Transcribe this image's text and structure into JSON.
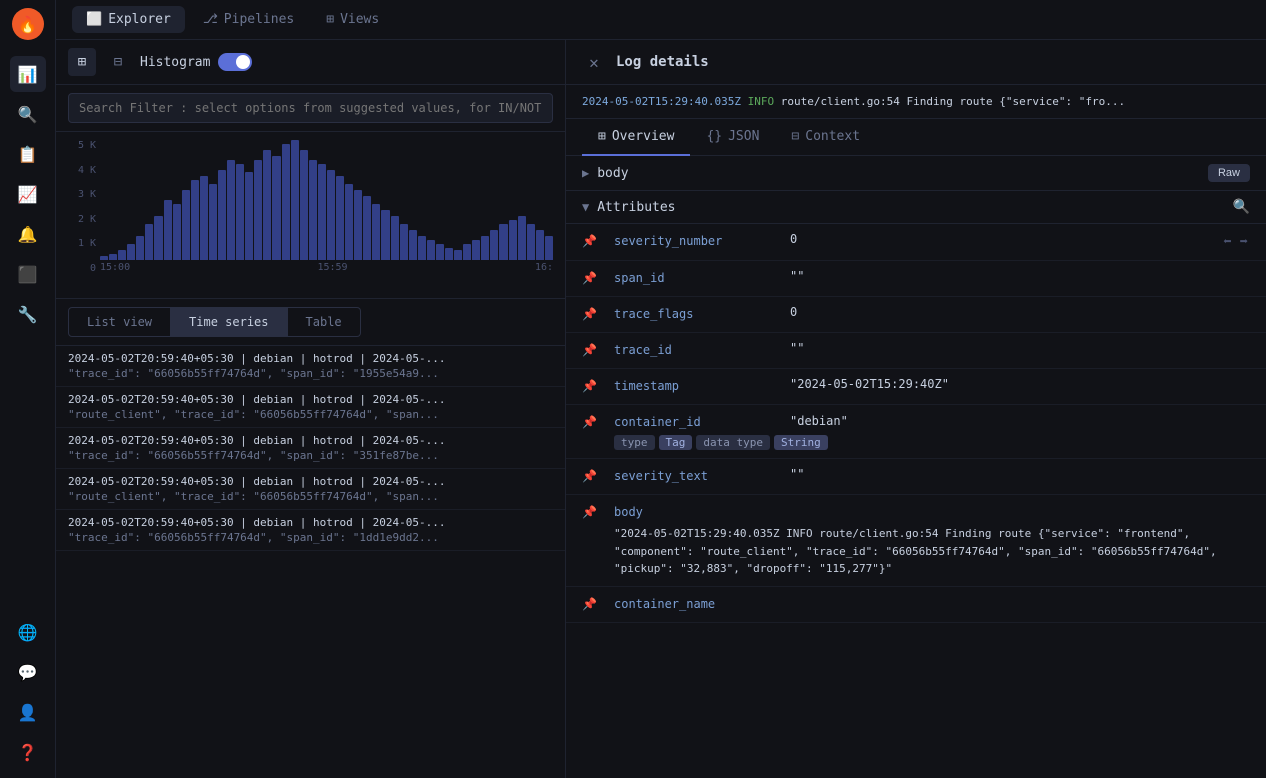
{
  "app": {
    "title": "Log details"
  },
  "sidebar": {
    "logo": "🔥",
    "icons": [
      "📊",
      "🔍",
      "📋",
      "📈",
      "🔔",
      "🔧",
      "⚙️"
    ],
    "bottom_icons": [
      "🌐",
      "💬",
      "👤",
      "❓"
    ]
  },
  "nav": {
    "tabs": [
      {
        "label": "Explorer",
        "active": true,
        "icon": "⬜"
      },
      {
        "label": "Pipelines",
        "active": false,
        "icon": "⎇"
      },
      {
        "label": "Views",
        "active": false,
        "icon": "⊞"
      }
    ]
  },
  "toolbar": {
    "histogram_label": "Histogram",
    "toggle_on": true
  },
  "search": {
    "placeholder": "Search Filter : select options from suggested values, for IN/NOT IN opera..."
  },
  "chart": {
    "y_labels": [
      "5 K",
      "4 K",
      "3 K",
      "2 K",
      "1 K",
      "0"
    ],
    "x_labels": [
      "15:00",
      "15:59",
      "16:"
    ],
    "bars": [
      2,
      3,
      5,
      8,
      12,
      18,
      22,
      30,
      28,
      35,
      40,
      42,
      38,
      45,
      50,
      48,
      44,
      50,
      55,
      52,
      58,
      60,
      55,
      50,
      48,
      45,
      42,
      38,
      35,
      32,
      28,
      25,
      22,
      18,
      15,
      12,
      10,
      8,
      6,
      5,
      8,
      10,
      12,
      15,
      18,
      20,
      22,
      18,
      15,
      12
    ]
  },
  "view_tabs": [
    {
      "label": "List view",
      "active": false
    },
    {
      "label": "Time series",
      "active": true
    },
    {
      "label": "Table",
      "active": false
    }
  ],
  "logs": [
    {
      "line1": "2024-05-02T20:59:40+05:30  |  debian  |  hotrod  |  2024-05-...",
      "line2": "\"trace_id\": \"66056b55ff74764d\", \"span_id\": \"1955e54a9..."
    },
    {
      "line1": "2024-05-02T20:59:40+05:30  |  debian  |  hotrod  |  2024-05-...",
      "line2": "\"route_client\", \"trace_id\": \"66056b55ff74764d\", \"span..."
    },
    {
      "line1": "2024-05-02T20:59:40+05:30  |  debian  |  hotrod  |  2024-05-...",
      "line2": "\"trace_id\": \"66056b55ff74764d\", \"span_id\": \"351fe87be..."
    },
    {
      "line1": "2024-05-02T20:59:40+05:30  |  debian  |  hotrod  |  2024-05-...",
      "line2": "\"route_client\", \"trace_id\": \"66056b55ff74764d\", \"span..."
    },
    {
      "line1": "2024-05-02T20:59:40+05:30  |  debian  |  hotrod  |  2024-05-...",
      "line2": "\"trace_id\": \"66056b55ff74764d\", \"span_id\": \"1dd1e9dd2..."
    }
  ],
  "detail": {
    "title": "Log details",
    "log_preview": "2024-05-02T15:29:40.035Z  INFO  route/client.go:54  Finding route  {\"service\": \"fro...",
    "tabs": [
      {
        "label": "Overview",
        "icon": "⊞",
        "active": true
      },
      {
        "label": "JSON",
        "icon": "{}",
        "active": false
      },
      {
        "label": "Context",
        "icon": "⊟",
        "active": false
      }
    ],
    "sections": {
      "body": {
        "name": "body",
        "raw_label": "Raw"
      },
      "attributes": {
        "name": "Attributes"
      }
    },
    "attributes": [
      {
        "name": "severity_number",
        "value": "0",
        "has_tags": false,
        "show_actions": true
      },
      {
        "name": "span_id",
        "value": "\"\"",
        "has_tags": false,
        "show_actions": false
      },
      {
        "name": "trace_flags",
        "value": "0",
        "has_tags": false,
        "show_actions": false
      },
      {
        "name": "trace_id",
        "value": "\"\"",
        "has_tags": false,
        "show_actions": false
      },
      {
        "name": "timestamp",
        "value": "\"2024-05-02T15:29:40Z\"",
        "has_tags": false,
        "show_actions": false
      },
      {
        "name": "container_id",
        "value": "\"debian\"",
        "has_tags": true,
        "tags": [
          {
            "label": "type",
            "class": "tag-type"
          },
          {
            "label": "Tag",
            "class": "tag-tag"
          },
          {
            "label": "data type",
            "class": "tag-datatype"
          },
          {
            "label": "String",
            "class": "tag-string"
          }
        ]
      },
      {
        "name": "severity_text",
        "value": "\"\"",
        "has_tags": false,
        "show_actions": false
      },
      {
        "name": "body",
        "value": "\"2024-05-02T15:29:40.035Z INFO route/client.go:54 Finding route {\"service\": \"frontend\", \"component\": \"route_client\", \"trace_id\": \"66056b55ff74764d\", \"span_id\": \"66056b55ff74764d\", \"pickup\": \"32,883\", \"dropoff\": \"115,277\"}\"",
        "is_body": true,
        "has_tags": false
      },
      {
        "name": "container_name",
        "value": "",
        "has_tags": false,
        "show_actions": false
      }
    ]
  }
}
